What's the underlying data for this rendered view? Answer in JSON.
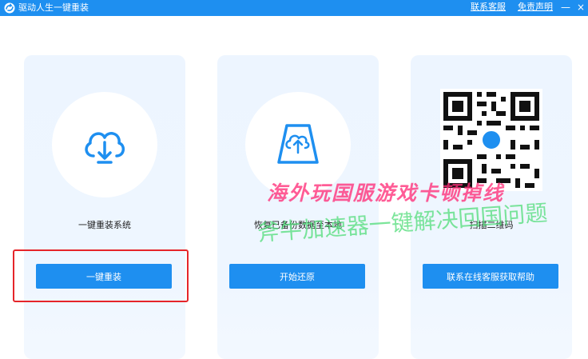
{
  "window": {
    "title": "驱动人生一键重装",
    "links": {
      "support": "联系客服",
      "disclaimer": "免责声明"
    },
    "minimize_glyph": "—",
    "close_glyph": "×"
  },
  "panels": [
    {
      "icon": "cloud-download-icon",
      "label": "一键重装系统",
      "button": "一键重装"
    },
    {
      "icon": "disk-restore-icon",
      "label": "恢复已备份数据至本地",
      "button": "开始还原"
    },
    {
      "icon": "qr-code-icon",
      "label": "扫描二维码",
      "button": "联系在线客服获取帮助"
    }
  ],
  "watermarks": {
    "line1": "海外玩国服游戏卡顿掉线",
    "line2": "斧牛加速器一键解决回国问题"
  },
  "colors": {
    "brand": "#1e8ff0",
    "panel_bg": "#eef6ff",
    "highlight": "#e5252a"
  }
}
